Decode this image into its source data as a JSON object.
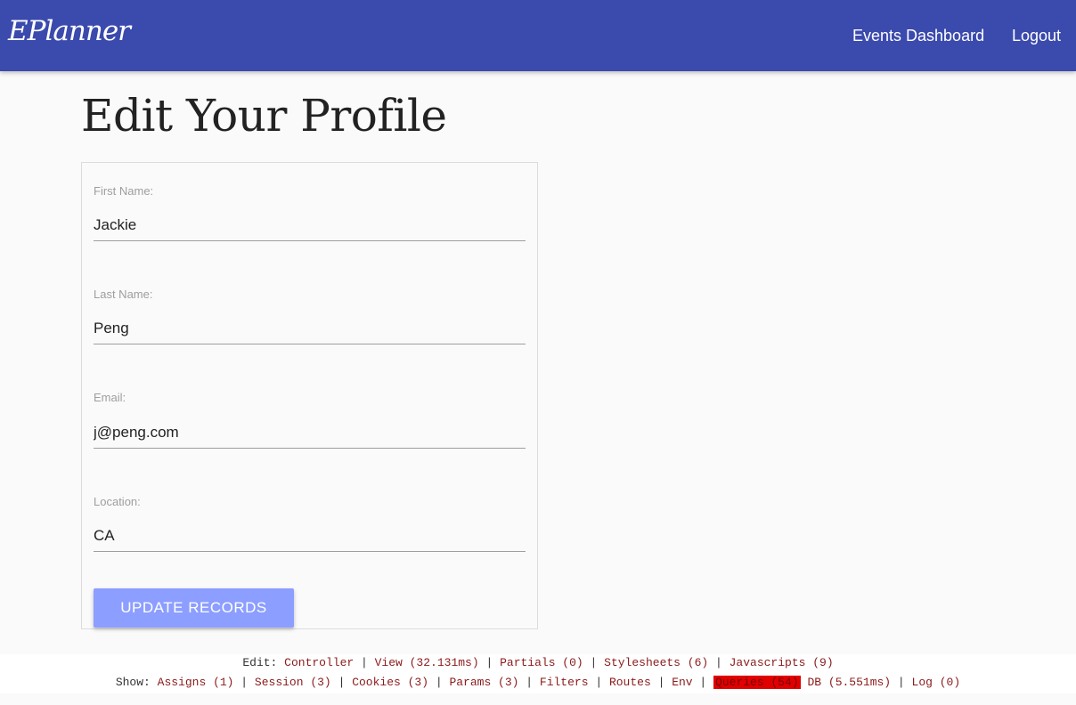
{
  "navbar": {
    "brand": "EPlanner",
    "links": [
      "Events Dashboard",
      "Logout"
    ]
  },
  "page": {
    "title": "Edit Your Profile"
  },
  "form": {
    "fields": [
      {
        "label": "First Name:",
        "value": "Jackie"
      },
      {
        "label": "Last Name:",
        "value": "Peng"
      },
      {
        "label": "Email:",
        "value": "j@peng.com"
      },
      {
        "label": "Location:",
        "value": "CA"
      }
    ],
    "submit_label": "UPDATE RECORDS"
  },
  "debug": {
    "edit_prefix": "Edit:",
    "edit_links": [
      "Controller",
      "View (32.131ms)",
      "Partials (0)",
      "Stylesheets (6)",
      "Javascripts (9)"
    ],
    "show_prefix": "Show:",
    "show_links": [
      "Assigns (1)",
      "Session (3)",
      "Cookies (3)",
      "Params (3)",
      "Filters",
      "Routes",
      "Env",
      "Queries (54)",
      "DB (5.551ms)",
      "Log (0)"
    ],
    "separator": "|",
    "highlight_color": "#e00000"
  },
  "colors": {
    "navbar": "#3b4aad",
    "button": "#8c9eff"
  }
}
